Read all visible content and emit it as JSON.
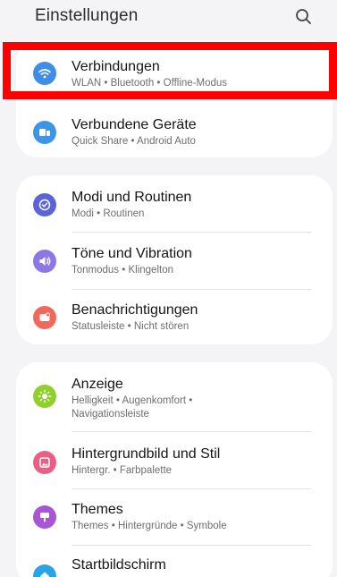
{
  "header": {
    "title": "Einstellungen",
    "search_icon": "search-icon"
  },
  "groups": [
    {
      "items": [
        {
          "title": "Verbindungen",
          "subtitle": "WLAN • Bluetooth • Offline-Modus",
          "icon": "wifi-icon",
          "color": "#3e8ee8"
        },
        {
          "title": "Verbundene Geräte",
          "subtitle": "Quick Share • Android Auto",
          "icon": "connected-devices-icon",
          "color": "#3d95e6"
        }
      ]
    },
    {
      "items": [
        {
          "title": "Modi und Routinen",
          "subtitle": "Modi • Routinen",
          "icon": "modes-icon",
          "color": "#5a63d8"
        },
        {
          "title": "Töne und Vibration",
          "subtitle": "Tonmodus • Klingelton",
          "icon": "sound-icon",
          "color": "#8c77e4"
        },
        {
          "title": "Benachrichtigungen",
          "subtitle": "Statusleiste • Nicht stören",
          "icon": "notifications-icon",
          "color": "#ef6a5c"
        }
      ]
    },
    {
      "items": [
        {
          "title": "Anzeige",
          "subtitle": "Helligkeit • Augenkomfort • Navigationsleiste",
          "icon": "brightness-icon",
          "color": "#8fd02e"
        },
        {
          "title": "Hintergrundbild und Stil",
          "subtitle": "Hintergr. • Farbpalette",
          "icon": "wallpaper-icon",
          "color": "#ea5f85"
        },
        {
          "title": "Themes",
          "subtitle": "Themes • Hintergründe • Symbole",
          "icon": "themes-icon",
          "color": "#a856d6"
        },
        {
          "title": "Startbildschirm",
          "subtitle": "",
          "icon": "home-screen-icon",
          "color": "#2aa4e4"
        }
      ]
    }
  ],
  "colors": {
    "background": "#f4f4f6",
    "card": "#ffffff",
    "highlight": "#ff0000"
  }
}
